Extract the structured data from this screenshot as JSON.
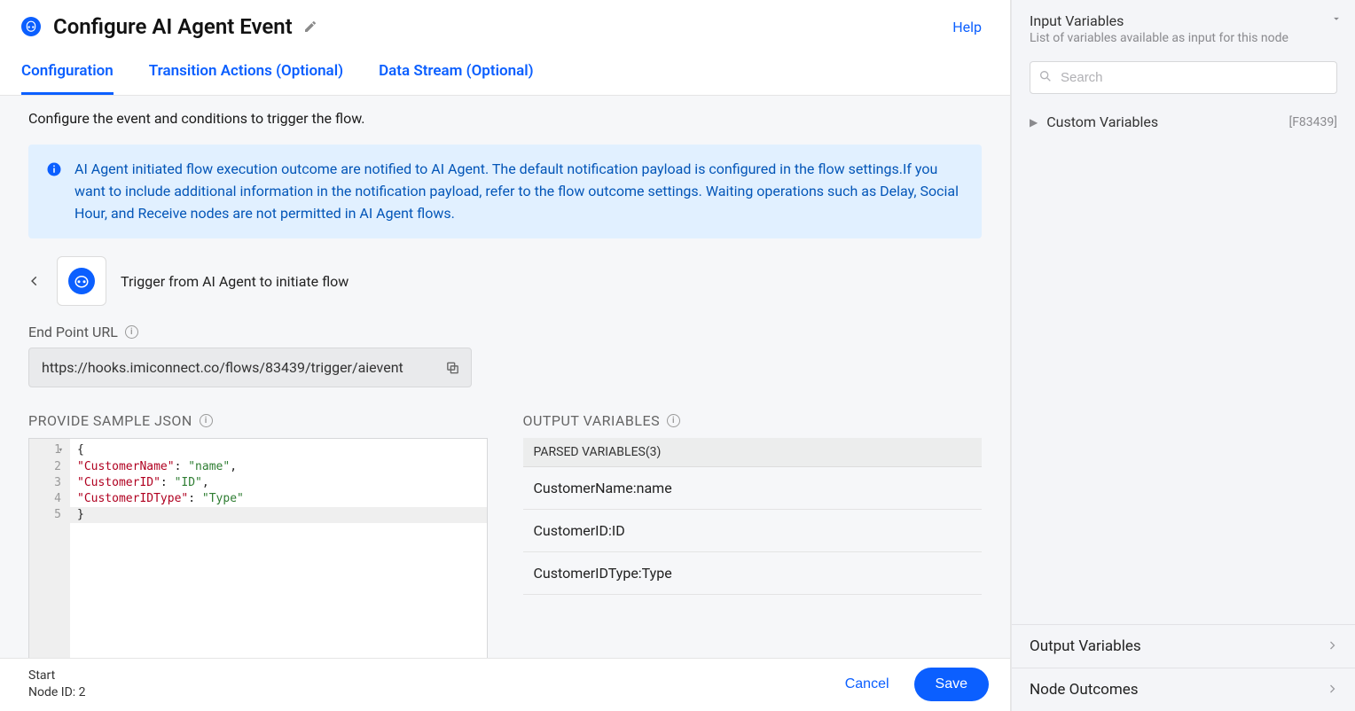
{
  "header": {
    "title": "Configure AI Agent Event",
    "help": "Help"
  },
  "tabs": {
    "config": "Configuration",
    "transition": "Transition Actions (Optional)",
    "datastream": "Data Stream (Optional)"
  },
  "intro": "Configure the event and conditions to trigger the flow.",
  "banner": "AI Agent initiated flow execution outcome are notified to AI Agent. The default notification payload is configured in the flow settings.If you want to include additional information in the notification payload, refer to the flow outcome settings. Waiting operations such as Delay, Social Hour, and Receive nodes are not permitted in AI Agent flows.",
  "trigger": {
    "label": "Trigger from AI Agent to initiate flow"
  },
  "endpoint": {
    "label": "End Point URL",
    "value": "https://hooks.imiconnect.co/flows/83439/trigger/aievent"
  },
  "json_section": {
    "title": "PROVIDE SAMPLE JSON",
    "lines": {
      "l1": "{",
      "l2a": "\"CustomerName\"",
      "l2b": ": ",
      "l2c": "\"name\"",
      "l2d": ",",
      "l3a": "\"CustomerID\"",
      "l3b": ": ",
      "l3c": "\"ID\"",
      "l3d": ",",
      "l4a": "\"CustomerIDType\"",
      "l4b": ": ",
      "l4c": "\"Type\"",
      "l5": "}"
    }
  },
  "output": {
    "title": "OUTPUT VARIABLES",
    "parsed_header": "PARSED VARIABLES(3)",
    "items": {
      "i1": "CustomerName:name",
      "i2": "CustomerID:ID",
      "i3": "CustomerIDType:Type"
    }
  },
  "footer": {
    "start": "Start",
    "node": "Node ID: 2",
    "cancel": "Cancel",
    "save": "Save"
  },
  "side": {
    "title": "Input Variables",
    "subtitle": "List of variables available as input for this node",
    "search_placeholder": "Search",
    "custom": "Custom Variables",
    "custom_tag": "[F83439]",
    "outvars": "Output Variables",
    "outcomes": "Node Outcomes"
  }
}
